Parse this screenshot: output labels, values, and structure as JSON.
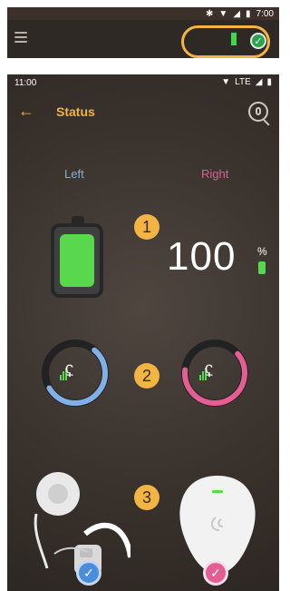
{
  "top": {
    "status_time": "7:00",
    "status_icons": [
      "bluetooth-icon",
      "wifi-icon",
      "signal-icon",
      "battery-icon"
    ]
  },
  "phone": {
    "status_time": "11:00",
    "network": "LTE",
    "title": "Status",
    "back_icon": "arrow-left-icon",
    "search_icon": "search-mic-icon",
    "left_label": "Left",
    "right_label": "Right",
    "battery_percent": "100",
    "percent_sign": "%",
    "step_labels": [
      "1",
      "2",
      "3"
    ],
    "colors": {
      "accent": "#f2b544",
      "left": "#7fb0e6",
      "right": "#e45d93",
      "battery": "#59d84e"
    }
  }
}
